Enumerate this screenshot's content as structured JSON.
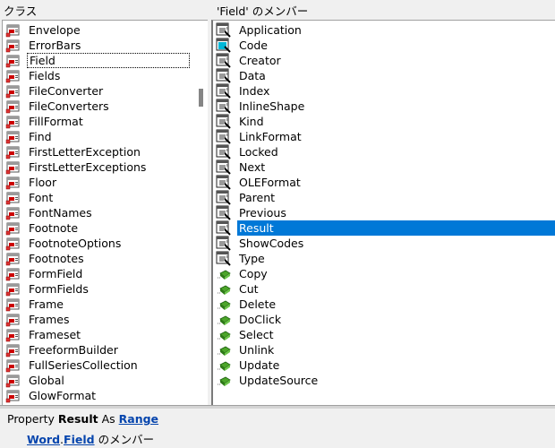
{
  "classes_pane": {
    "header": "クラス",
    "focused_index": 2,
    "items": [
      {
        "label": "Envelope"
      },
      {
        "label": "ErrorBars"
      },
      {
        "label": "Field"
      },
      {
        "label": "Fields"
      },
      {
        "label": "FileConverter"
      },
      {
        "label": "FileConverters"
      },
      {
        "label": "FillFormat"
      },
      {
        "label": "Find"
      },
      {
        "label": "FirstLetterException"
      },
      {
        "label": "FirstLetterExceptions"
      },
      {
        "label": "Floor"
      },
      {
        "label": "Font"
      },
      {
        "label": "FontNames"
      },
      {
        "label": "Footnote"
      },
      {
        "label": "FootnoteOptions"
      },
      {
        "label": "Footnotes"
      },
      {
        "label": "FormField"
      },
      {
        "label": "FormFields"
      },
      {
        "label": "Frame"
      },
      {
        "label": "Frames"
      },
      {
        "label": "Frameset"
      },
      {
        "label": "FreeformBuilder"
      },
      {
        "label": "FullSeriesCollection"
      },
      {
        "label": "Global"
      },
      {
        "label": "GlowFormat"
      }
    ],
    "icon": "class-icon"
  },
  "members_pane": {
    "header": "'Field' のメンバー",
    "selected_index": 13,
    "items": [
      {
        "label": "Application",
        "icon": "property-icon"
      },
      {
        "label": "Code",
        "icon": "default-property-icon"
      },
      {
        "label": "Creator",
        "icon": "property-icon"
      },
      {
        "label": "Data",
        "icon": "property-icon"
      },
      {
        "label": "Index",
        "icon": "property-icon"
      },
      {
        "label": "InlineShape",
        "icon": "property-icon"
      },
      {
        "label": "Kind",
        "icon": "property-icon"
      },
      {
        "label": "LinkFormat",
        "icon": "property-icon"
      },
      {
        "label": "Locked",
        "icon": "property-icon"
      },
      {
        "label": "Next",
        "icon": "property-icon"
      },
      {
        "label": "OLEFormat",
        "icon": "property-icon"
      },
      {
        "label": "Parent",
        "icon": "property-icon"
      },
      {
        "label": "Previous",
        "icon": "property-icon"
      },
      {
        "label": "Result",
        "icon": "property-icon"
      },
      {
        "label": "ShowCodes",
        "icon": "property-icon"
      },
      {
        "label": "Type",
        "icon": "property-icon"
      },
      {
        "label": "Copy",
        "icon": "method-icon"
      },
      {
        "label": "Cut",
        "icon": "method-icon"
      },
      {
        "label": "Delete",
        "icon": "method-icon"
      },
      {
        "label": "DoClick",
        "icon": "method-icon"
      },
      {
        "label": "Select",
        "icon": "method-icon"
      },
      {
        "label": "Unlink",
        "icon": "method-icon"
      },
      {
        "label": "Update",
        "icon": "method-icon"
      },
      {
        "label": "UpdateSource",
        "icon": "method-icon"
      }
    ]
  },
  "details": {
    "kind": "Property",
    "name": "Result",
    "as": "As",
    "type_link": "Range",
    "library_link": "Word",
    "dot": ".",
    "class_link": "Field",
    "suffix": "のメンバー"
  },
  "colors": {
    "selection": "#0078d7",
    "link": "#0645ad"
  }
}
